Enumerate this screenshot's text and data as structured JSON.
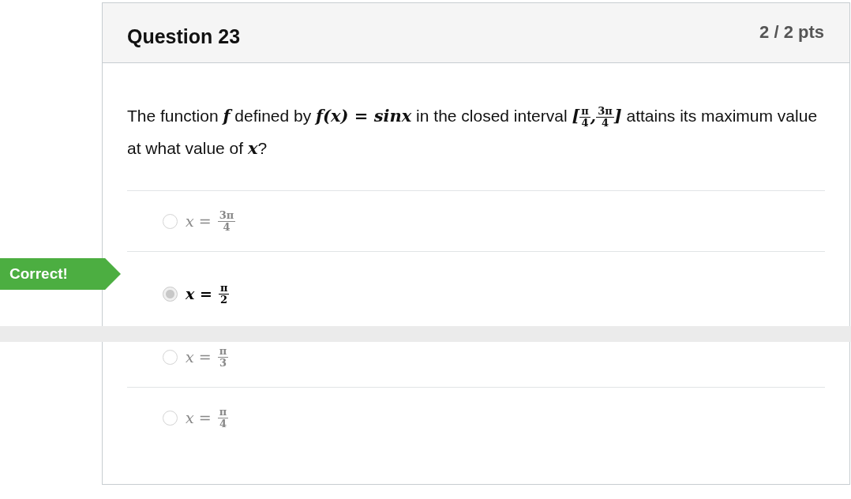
{
  "question": {
    "title": "Question 23",
    "points": "2 / 2 pts",
    "text_parts": [
      {
        "kind": "text",
        "text": "The function "
      },
      {
        "kind": "math",
        "text": "f"
      },
      {
        "kind": "text",
        "text": " defined by "
      },
      {
        "kind": "math",
        "text": "f(x) = sinx"
      },
      {
        "kind": "text",
        "text": " in the closed interval "
      },
      {
        "kind": "math",
        "text": "["
      },
      {
        "kind": "fraction",
        "numerator": "π",
        "denominator": "4"
      },
      {
        "kind": "math",
        "text": ","
      },
      {
        "kind": "fraction",
        "numerator": "3π",
        "denominator": "4"
      },
      {
        "kind": "math",
        "text": "]"
      },
      {
        "kind": "text",
        "text": " attains its maximum value at what value of "
      },
      {
        "kind": "math",
        "text": "x"
      },
      {
        "kind": "text",
        "text": "?"
      }
    ],
    "answers": [
      {
        "lhs": "x =",
        "numerator": "3π",
        "denominator": "4",
        "selected": false
      },
      {
        "lhs": "x =",
        "numerator": "π",
        "denominator": "2",
        "selected": true,
        "banner": "Correct!"
      },
      {
        "lhs": "x =",
        "numerator": "π",
        "denominator": "3",
        "selected": false
      },
      {
        "lhs": "x =",
        "numerator": "π",
        "denominator": "4",
        "selected": false
      }
    ]
  }
}
